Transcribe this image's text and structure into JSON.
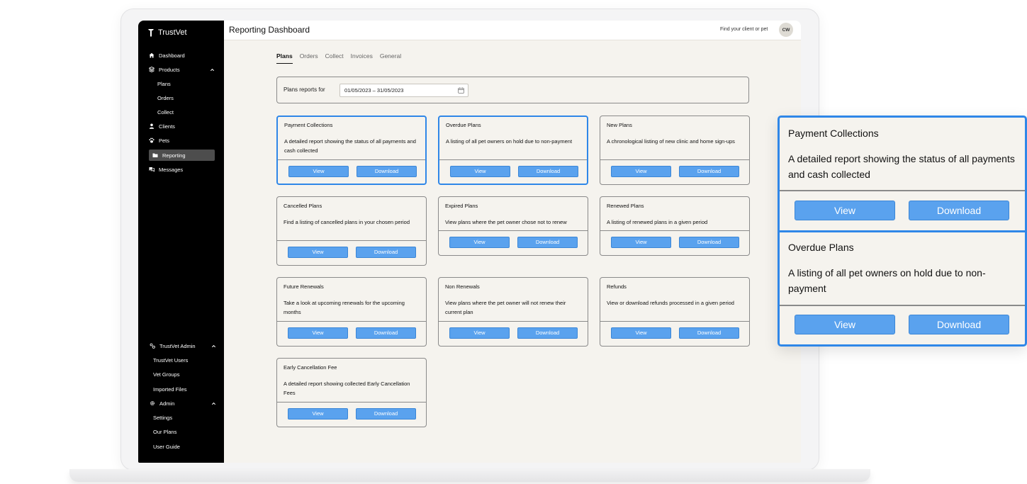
{
  "app": {
    "brand": "TrustVet",
    "page_title": "Reporting Dashboard"
  },
  "header": {
    "search_link": "Find your client or pet",
    "avatar_initials": "CW"
  },
  "sidebar": {
    "items": [
      {
        "label": "Dashboard",
        "icon": "home-icon"
      },
      {
        "label": "Products",
        "icon": "layers-icon"
      },
      {
        "label": "Plans"
      },
      {
        "label": "Orders"
      },
      {
        "label": "Collect"
      },
      {
        "label": "Clients",
        "icon": "user-icon"
      },
      {
        "label": "Pets",
        "icon": "paw-icon"
      },
      {
        "label": "Reporting",
        "icon": "folder-icon",
        "active": true
      },
      {
        "label": "Messages",
        "icon": "chat-icon"
      }
    ],
    "admin": [
      {
        "label": "TrustVet Admin",
        "icon": "users-cog-icon"
      },
      {
        "label": "TrustVet Users"
      },
      {
        "label": "Vet Groups"
      },
      {
        "label": "Imported Files"
      },
      {
        "label": "Admin",
        "icon": "gear-icon"
      },
      {
        "label": "Settings"
      },
      {
        "label": "Our Plans"
      },
      {
        "label": "User Guide"
      }
    ]
  },
  "tabs": [
    "Plans",
    "Orders",
    "Collect",
    "Invoices",
    "General"
  ],
  "active_tab": "Plans",
  "filter": {
    "label": "Plans reports for",
    "date_range": "01/05/2023 – 31/05/2023"
  },
  "buttons": {
    "view": "View",
    "download": "Download"
  },
  "cards": [
    {
      "title": "Payment Collections",
      "desc": "A detailed report showing the status of all payments and cash collected",
      "highlighted": true
    },
    {
      "title": "Overdue Plans",
      "desc": "A listing of all pet owners on hold due to non-payment",
      "highlighted": true
    },
    {
      "title": "New Plans",
      "desc": "A chronological listing of new clinic and home sign-ups"
    },
    {
      "title": "Cancelled Plans",
      "desc": "Find a listing of cancelled plans in your chosen period"
    },
    {
      "title": "Expired Plans",
      "desc": "View plans where the pet owner chose not to renew"
    },
    {
      "title": "Renewed Plans",
      "desc": "A listing of renewed plans in a given period"
    },
    {
      "title": "Future Renewals",
      "desc": "Take a look at upcoming renewals for the upcoming months"
    },
    {
      "title": "Non Renewals",
      "desc": "View plans where the pet owner will not renew their current plan"
    },
    {
      "title": "Refunds",
      "desc": "View or download refunds processed in a given period"
    },
    {
      "title": "Early Cancellation Fee",
      "desc": "A detailed report showing collected Early Cancellation Fees"
    }
  ],
  "zoom": [
    {
      "title": "Payment Collections",
      "desc": "A detailed report showing the status of all payments and cash collected"
    },
    {
      "title": "Overdue Plans",
      "desc": "A listing of all pet owners on hold due to non-payment"
    }
  ],
  "colors": {
    "accent": "#2f87e8",
    "button": "#5aa2ee",
    "sidebar": "#000000",
    "background": "#f5f3ee"
  }
}
